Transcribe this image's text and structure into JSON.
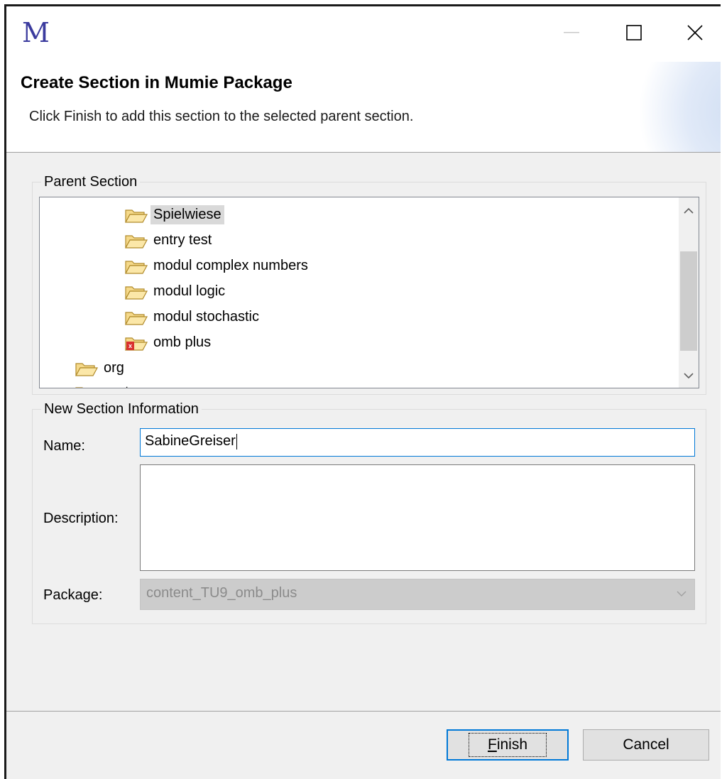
{
  "window": {
    "app_icon_letter": "M",
    "controls": {
      "minimize": "minimize-icon",
      "maximize": "maximize-icon",
      "close": "close-icon"
    }
  },
  "header": {
    "title": "Create Section in Mumie Package",
    "message": "Click Finish to add this section to the selected parent section."
  },
  "parent_section": {
    "legend": "Parent Section",
    "items": [
      {
        "label": "Spielwiese",
        "icon": "folder-open-icon",
        "selected": true
      },
      {
        "label": "entry test",
        "icon": "folder-open-icon"
      },
      {
        "label": "modul complex numbers",
        "icon": "folder-open-icon"
      },
      {
        "label": "modul logic",
        "icon": "folder-open-icon"
      },
      {
        "label": "modul stochastic",
        "icon": "folder-open-icon"
      },
      {
        "label": "omb plus",
        "icon": "folder-error-icon"
      },
      {
        "label": "org",
        "icon": "folder-open-icon"
      },
      {
        "label": "system",
        "icon": "folder-open-icon"
      }
    ]
  },
  "new_section": {
    "legend": "New Section Information",
    "name_label": "Name:",
    "name_value": "SabineGreiser",
    "description_label": "Description:",
    "description_value": "",
    "package_label": "Package:",
    "package_value": "content_TU9_omb_plus"
  },
  "buttons": {
    "finish_mnemonic": "F",
    "finish_rest": "inish",
    "cancel": "Cancel"
  },
  "colors": {
    "accent": "#0078d7",
    "selection": "#d9d9d9",
    "error": "#d9302f"
  }
}
